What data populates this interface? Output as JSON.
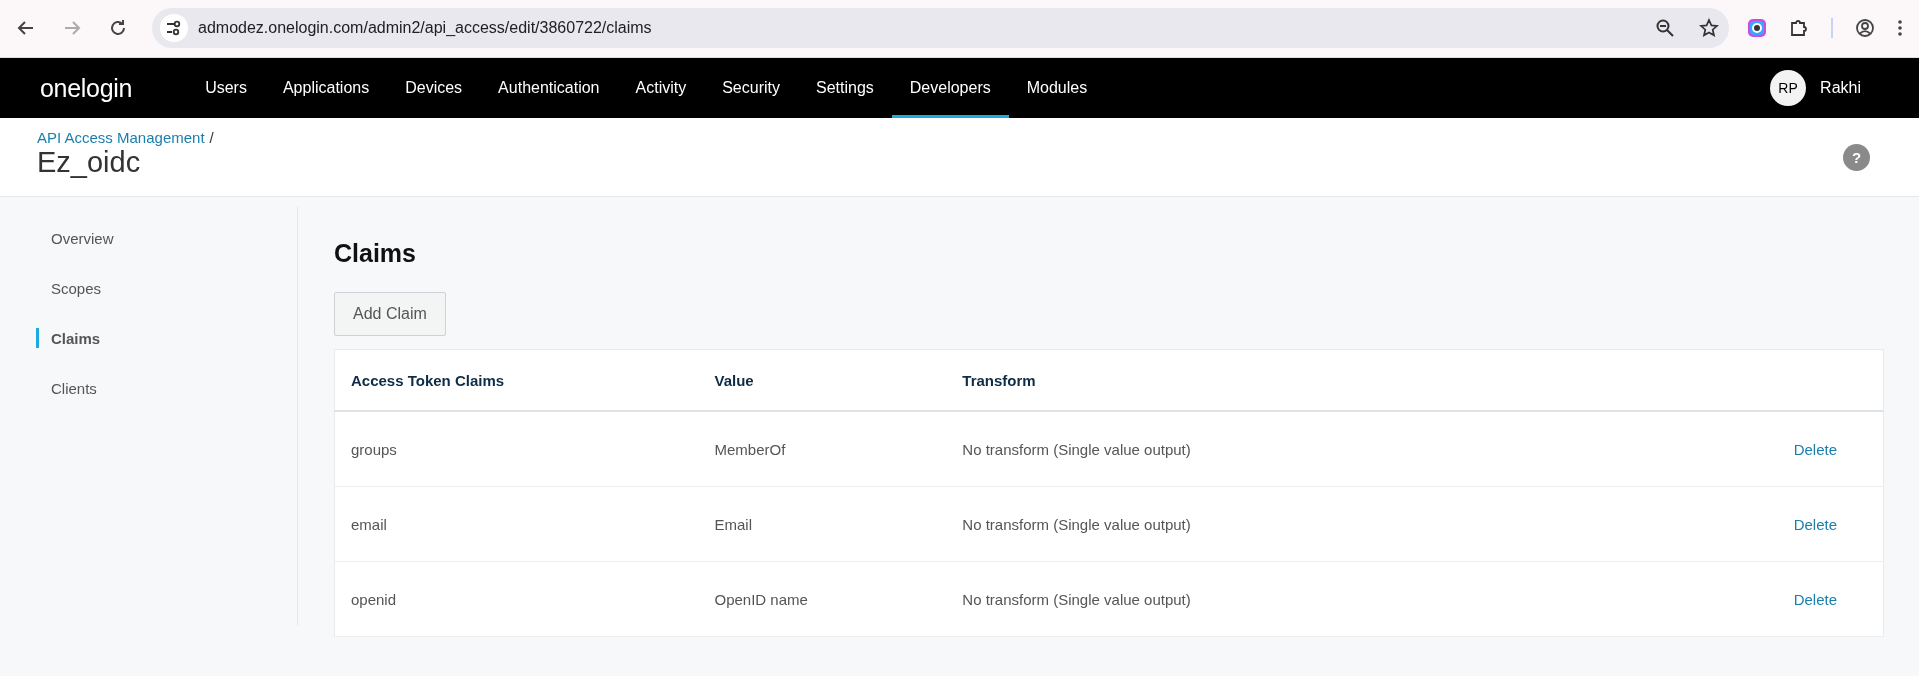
{
  "browser": {
    "url": "admodez.onelogin.com/admin2/api_access/edit/3860722/claims"
  },
  "nav": {
    "logo": "onelogin",
    "items": [
      {
        "label": "Users",
        "selected": false
      },
      {
        "label": "Applications",
        "selected": false
      },
      {
        "label": "Devices",
        "selected": false
      },
      {
        "label": "Authentication",
        "selected": false
      },
      {
        "label": "Activity",
        "selected": false
      },
      {
        "label": "Security",
        "selected": false
      },
      {
        "label": "Settings",
        "selected": false
      },
      {
        "label": "Developers",
        "selected": true
      },
      {
        "label": "Modules",
        "selected": false
      }
    ],
    "user": {
      "initials": "RP",
      "name": "Rakhi"
    }
  },
  "header": {
    "breadcrumb": "API Access Management",
    "separator": "/",
    "title": "Ez_oidc",
    "help": "?"
  },
  "sidebar": {
    "items": [
      {
        "label": "Overview",
        "selected": false
      },
      {
        "label": "Scopes",
        "selected": false
      },
      {
        "label": "Claims",
        "selected": true
      },
      {
        "label": "Clients",
        "selected": false
      }
    ]
  },
  "main": {
    "title": "Claims",
    "add_button": "Add Claim",
    "table": {
      "columns": [
        "Access Token Claims",
        "Value",
        "Transform"
      ],
      "rows": [
        {
          "claim": "groups",
          "value": "MemberOf",
          "transform": "No transform (Single value output)",
          "action": "Delete"
        },
        {
          "claim": "email",
          "value": "Email",
          "transform": "No transform (Single value output)",
          "action": "Delete"
        },
        {
          "claim": "openid",
          "value": "OpenID name",
          "transform": "No transform (Single value output)",
          "action": "Delete"
        }
      ]
    }
  }
}
